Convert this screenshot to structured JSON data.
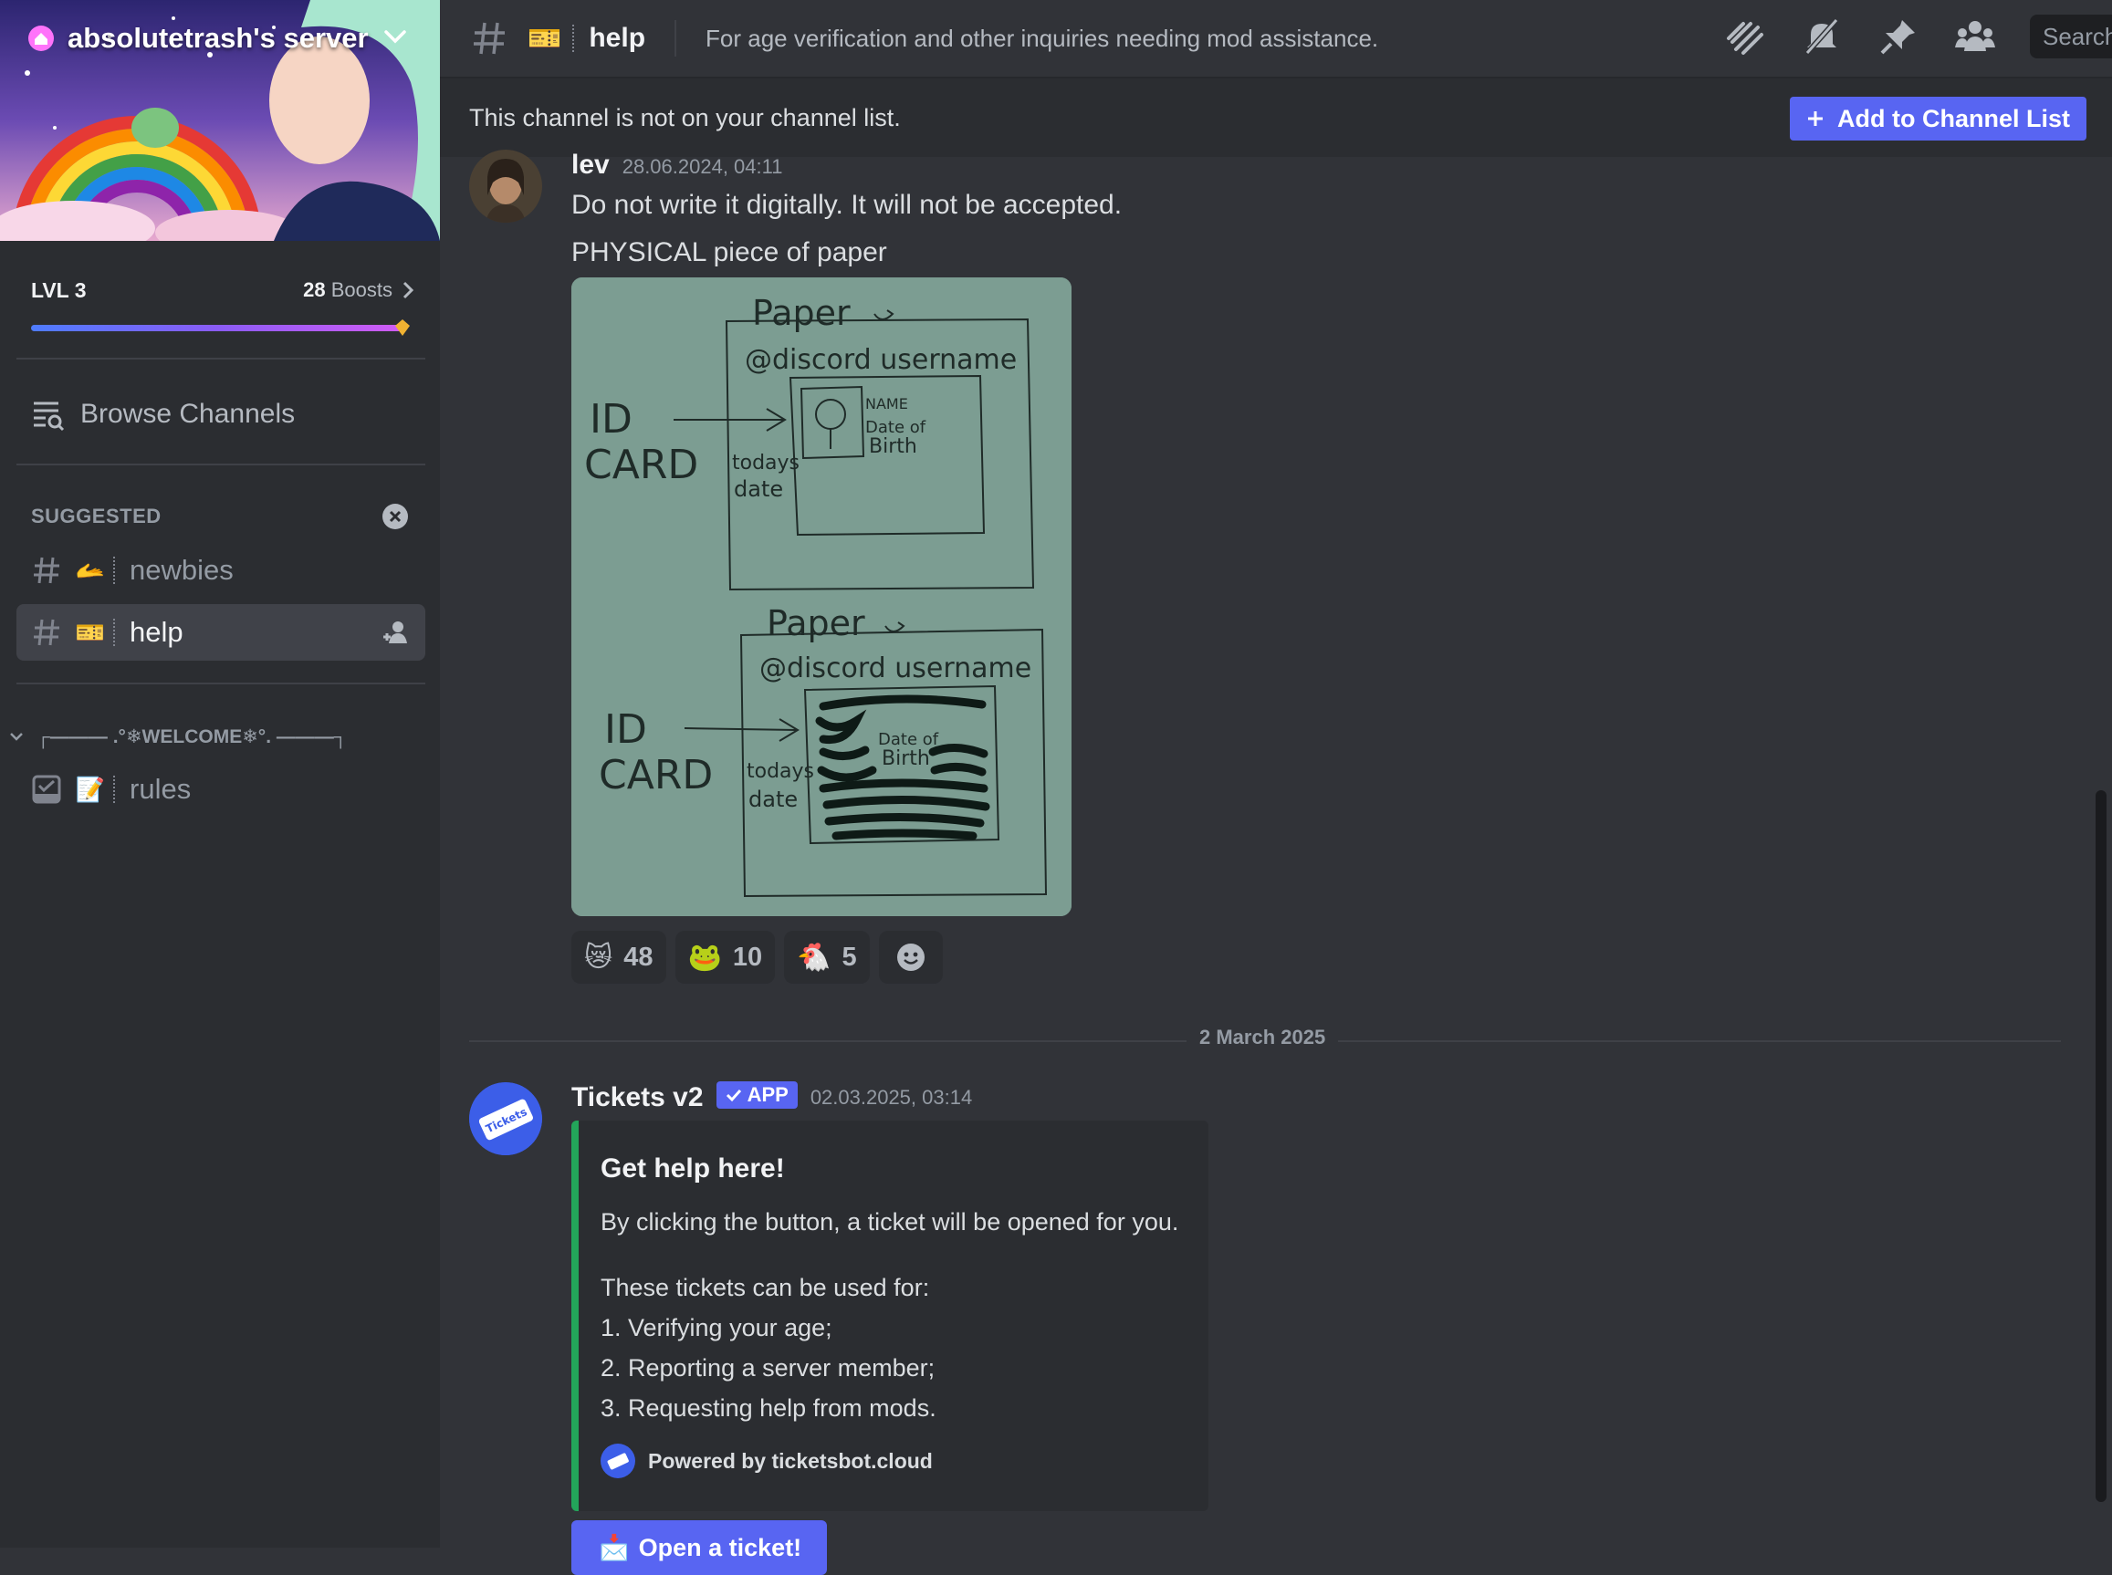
{
  "server": {
    "name": "absolutetrash's server",
    "level": "LVL 3",
    "boost_count": "28",
    "boost_label": "Boosts",
    "boost_progress": 0.98
  },
  "sidebar": {
    "browse_label": "Browse Channels",
    "suggested_title": "SUGGESTED",
    "channels": [
      {
        "emoji": "🫴",
        "name": "newbies"
      },
      {
        "emoji": "🎫",
        "name": "help"
      }
    ],
    "category": "┌——— .°❄WELCOME❄°. ———┐",
    "category_channels": [
      {
        "emoji": "📝",
        "name": "rules"
      }
    ]
  },
  "header": {
    "channel_emoji": "🎫",
    "channel_name": "help",
    "topic": "For age verification and other inquiries needing mod assistance.",
    "search_placeholder": "Search"
  },
  "notice": {
    "text": "This channel is not on your channel list.",
    "button_label": "Add to Channel List"
  },
  "messages": [
    {
      "author": "lev",
      "timestamp": "28.06.2024, 04:11",
      "lines": [
        "Do not write it digitally. It will not be accepted.",
        "PHYSICAL piece of paper"
      ],
      "attachment": {
        "top_label": "Paper",
        "username_label": "@discord username",
        "id_label_1": "ID",
        "id_label_2": "CARD",
        "todays_label_1": "todays",
        "todays_label_2": "date",
        "name_label": "NAME",
        "dob_label_1": "Date of",
        "dob_label_2": "Birth"
      },
      "reactions": [
        {
          "emoji": "😿",
          "count": "48"
        },
        {
          "emoji": "🐸",
          "count": "10"
        },
        {
          "emoji": "🐔",
          "count": "5"
        }
      ]
    }
  ],
  "date_divider": "2 March 2025",
  "bot_message": {
    "author": "Tickets v2",
    "badge": "APP",
    "timestamp": "02.03.2025, 03:14",
    "embed_title": "Get help here!",
    "embed_description": "By clicking the button, a ticket will be opened for you.",
    "embed_list_intro": "These tickets can be used for:",
    "embed_items": [
      "1. Verifying your age;",
      "2. Reporting a server member;",
      "3. Requesting help from mods."
    ],
    "footer": "Powered by ticketsbot.cloud",
    "button_label": "Open a ticket!",
    "button_emoji": "📩",
    "avatar_text": "Tickets"
  },
  "colors": {
    "accent": "#5865f2",
    "embed_bar": "#23a55a",
    "background": "#313338",
    "sidebar": "#2b2d31"
  }
}
